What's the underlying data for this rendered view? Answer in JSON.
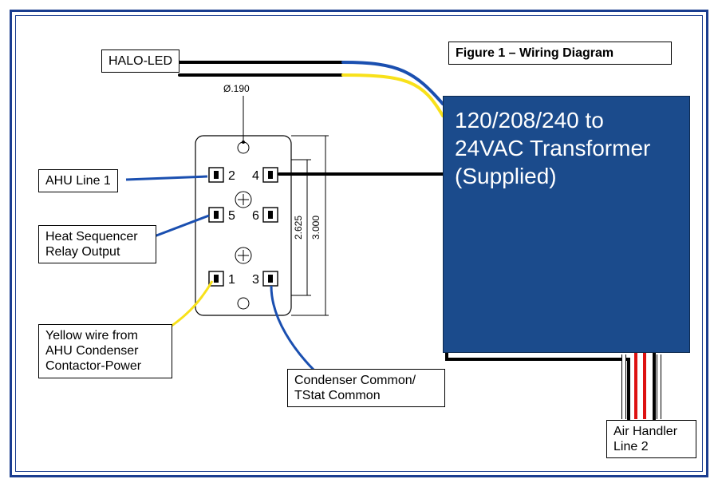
{
  "title": "Figure 1 – Wiring Diagram",
  "labels": {
    "halo_led": "HALO-LED",
    "ahu_line1": "AHU Line 1",
    "heat_seq": "Heat Sequencer Relay Output",
    "yellow_wire": "Yellow wire from AHU Condenser Contactor-Power",
    "condenser_common": "Condenser Common/ TStat Common",
    "air_handler": "Air Handler Line 2",
    "transformer": "120/208/240 to 24VAC Transformer (Supplied)"
  },
  "relay": {
    "pins": {
      "p1": "1",
      "p2": "2",
      "p3": "3",
      "p4": "4",
      "p5": "5",
      "p6": "6"
    },
    "dims": {
      "hole_dia": "Ø.190",
      "height_inner": "2.625",
      "height_outer": "3.000"
    }
  }
}
